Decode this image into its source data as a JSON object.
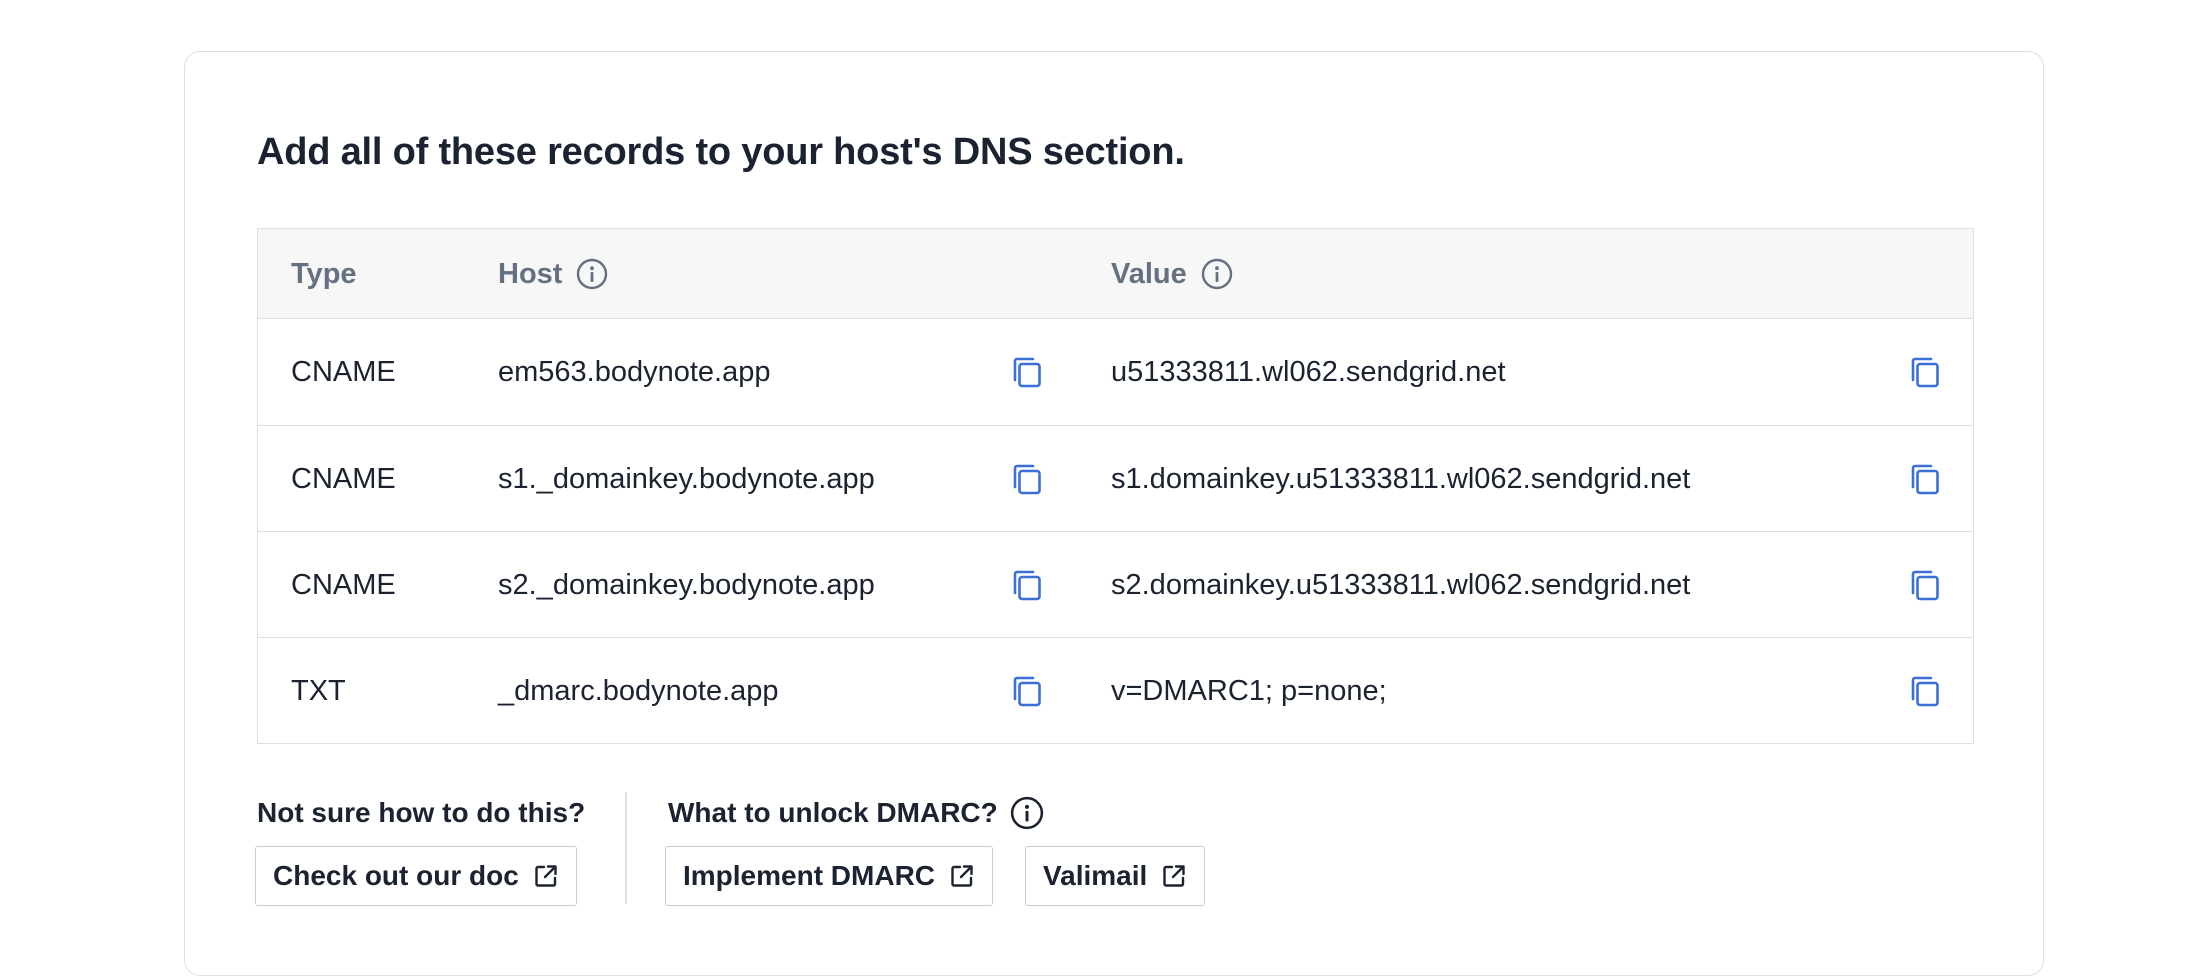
{
  "heading": "Add all of these records to your host's DNS section.",
  "table": {
    "columns": {
      "type": "Type",
      "host": "Host",
      "value": "Value"
    },
    "rows": [
      {
        "type": "CNAME",
        "host": "em563.bodynote.app",
        "value": "u51333811.wl062.sendgrid.net"
      },
      {
        "type": "CNAME",
        "host": "s1._domainkey.bodynote.app",
        "value": "s1.domainkey.u51333811.wl062.sendgrid.net"
      },
      {
        "type": "CNAME",
        "host": "s2._domainkey.bodynote.app",
        "value": "s2.domainkey.u51333811.wl062.sendgrid.net"
      },
      {
        "type": "TXT",
        "host": "_dmarc.bodynote.app",
        "value": "v=DMARC1; p=none;"
      }
    ]
  },
  "help": {
    "label": "Not sure how to do this?",
    "doc_button": "Check out our doc"
  },
  "dmarc": {
    "label": "What to unlock DMARC?",
    "implement_button": "Implement DMARC",
    "valimail_button": "Valimail"
  },
  "icons": {
    "info": "info-circle-icon",
    "copy": "copy-icon",
    "external": "external-link-icon"
  },
  "colors": {
    "copy_icon": "#3a6fd8",
    "header_text": "#657082",
    "border": "#dcdfe3"
  }
}
